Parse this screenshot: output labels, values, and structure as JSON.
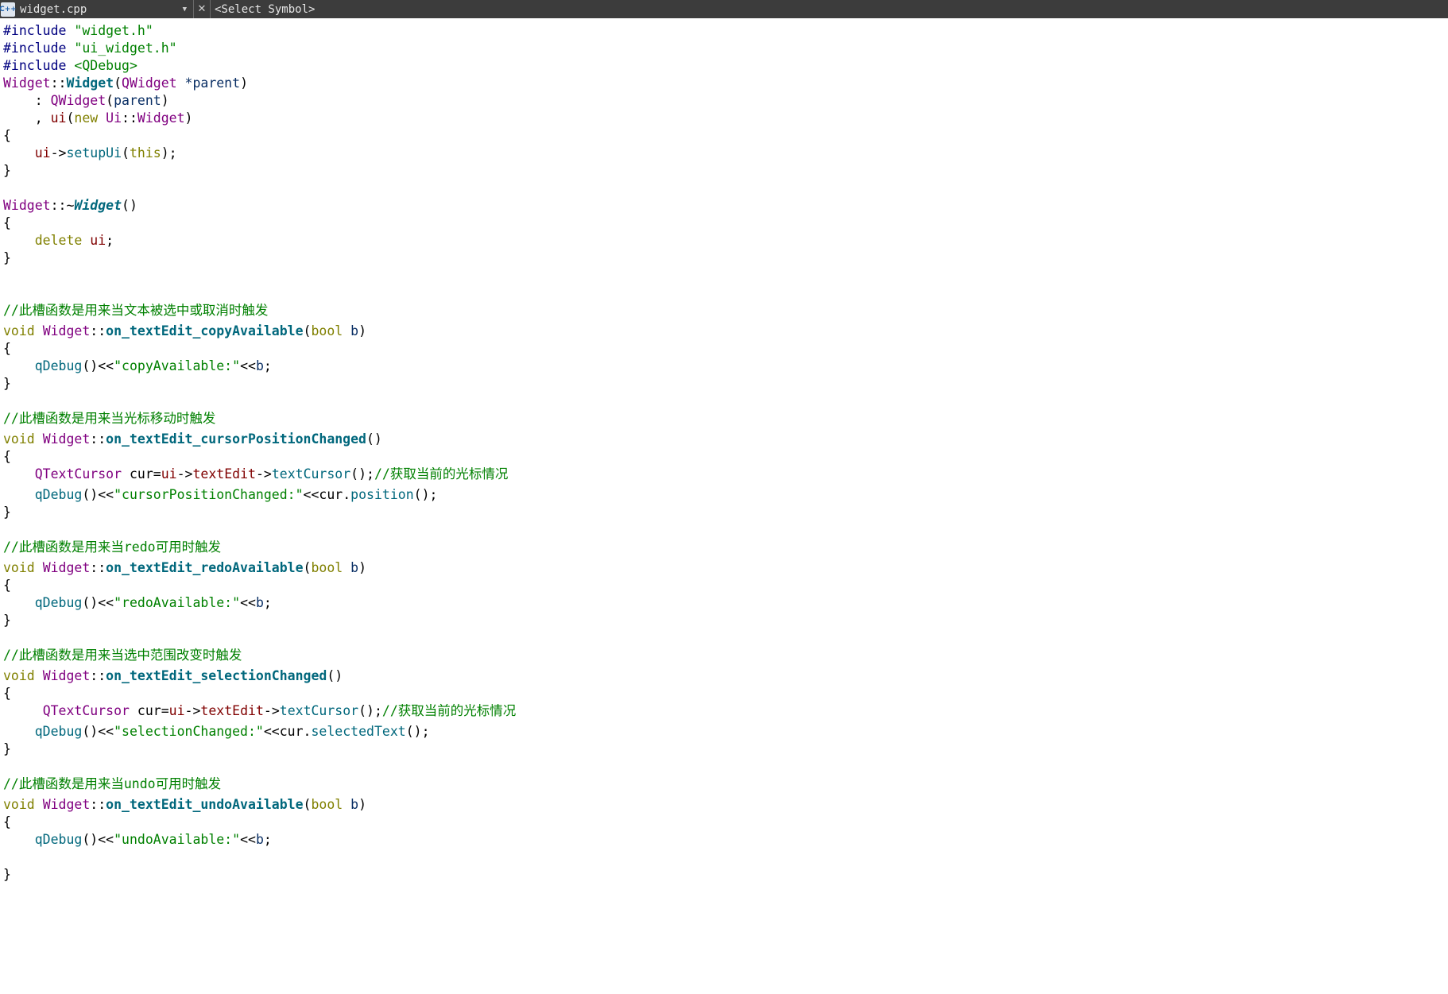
{
  "toolbar": {
    "file_icon_text": "C++",
    "file_name": "widget.cpp",
    "close_glyph": "✕",
    "symbol": "<Select Symbol>"
  },
  "code": {
    "include_kw": "#include",
    "inc1": "\"widget.h\"",
    "inc2": "\"ui_widget.h\"",
    "inc3": "<QDebug>",
    "cls": "Widget",
    "scope": "::",
    "ctor": "Widget",
    "qwidget": "QWidget",
    "parent_param": "*parent",
    "colon_init": "    : ",
    "parent_arg": "parent",
    "comma_init": "    , ",
    "ui_member": "ui",
    "new_kw": "new",
    "ui_ns": "Ui",
    "open_brace": "{",
    "close_brace": "}",
    "indent": "    ",
    "setup_ui": "setupUi",
    "this_kw": "this",
    "tilde": "~",
    "dtor": "Widget",
    "delete_kw": "delete",
    "void_kw": "void",
    "bool_kw": "bool",
    "b_param": "b",
    "qdebug": "qDebug",
    "qtextcursor": "QTextCursor",
    "cur_var": "cur",
    "text_edit": "textEdit",
    "text_cursor": "textCursor",
    "position": "position",
    "selected_text": "selectedText",
    "arrow": "->",
    "comment_copy": "//此槽函数是用来当文本被选中或取消时触发",
    "fn_copy": "on_textEdit_copyAvailable",
    "str_copy": "\"copyAvailable:\"",
    "comment_cursor": "//此槽函数是用来当光标移动时触发",
    "fn_cursor": "on_textEdit_cursorPositionChanged",
    "comment_get_cursor": "//获取当前的光标情况",
    "str_cursor": "\"cursorPositionChanged:\"",
    "comment_redo": "//此槽函数是用来当redo可用时触发",
    "fn_redo": "on_textEdit_redoAvailable",
    "str_redo": "\"redoAvailable:\"",
    "comment_selection": "//此槽函数是用来当选中范围改变时触发",
    "fn_selection": "on_textEdit_selectionChanged",
    "str_selection": "\"selectionChanged:\"",
    "comment_undo": "//此槽函数是用来当undo可用时触发",
    "fn_undo": "on_textEdit_undoAvailable",
    "str_undo": "\"undoAvailable:\""
  },
  "colors": {
    "toolbar_bg": "#3c3c3c",
    "preprocessor": "#000080",
    "string": "#008000",
    "type": "#800080",
    "keyword": "#808000",
    "function": "#00677c",
    "member": "#800000",
    "comment": "#008000"
  }
}
